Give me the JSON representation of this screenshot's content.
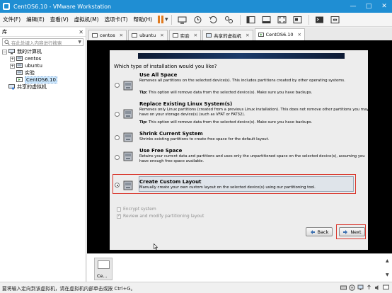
{
  "window": {
    "title": "CentOS6.10 - VMware Workstation"
  },
  "menu": {
    "items": [
      "文件(F)",
      "编辑(E)",
      "查看(V)",
      "虚拟机(M)",
      "选项卡(T)",
      "帮助(H)"
    ]
  },
  "library": {
    "header": "库",
    "search_placeholder": "在此处键入内容进行搜索",
    "tree": {
      "root": "我的计算机",
      "children": [
        "centos",
        "ubuntu",
        "实验",
        "CentOS6.10"
      ],
      "shared": "共享的虚拟机"
    }
  },
  "tabs": [
    "centos",
    "ubuntu",
    "实验",
    "共享的虚拟机",
    "CentOS6.10"
  ],
  "installer": {
    "question": "Which type of installation would you like?",
    "options": [
      {
        "title": "Use All Space",
        "desc": "Removes all partitions on the selected device(s). This includes partitions created by other operating systems.",
        "tip_label": "Tip:",
        "tip": " This option will remove data from the selected device(s). Make sure you have backups."
      },
      {
        "title": "Replace Existing Linux System(s)",
        "desc": "Removes only Linux partitions (created from a previous Linux installation). This does not remove other partitions you may have on your storage device(s) (such as VFAT or FAT32).",
        "tip_label": "Tip:",
        "tip": " This option will remove data from the selected device(s). Make sure you have backups."
      },
      {
        "title": "Shrink Current System",
        "desc": "Shrinks existing partitions to create free space for the default layout."
      },
      {
        "title": "Use Free Space",
        "desc": "Retains your current data and partitions and uses only the unpartitioned space on the selected device(s), assuming you have enough free space available."
      },
      {
        "title": "Create Custom Layout",
        "desc": "Manually create your own custom layout on the selected device(s) using our partitioning tool."
      }
    ],
    "selected_option": "Create Custom Layout",
    "encrypt_label": "Encrypt system",
    "review_label": "Review and modify partitioning layout",
    "back_label": "Back",
    "next_label": "Next"
  },
  "thumbnails": {
    "label": "Ce..."
  },
  "status": {
    "text": "要将输入定向到该虚拟机，请在虚拟机内部单击或按 Ctrl+G。"
  },
  "colors": {
    "titlebar": "#1f8ed3",
    "highlight": "#d9352b",
    "pause": "#e07a1f"
  }
}
